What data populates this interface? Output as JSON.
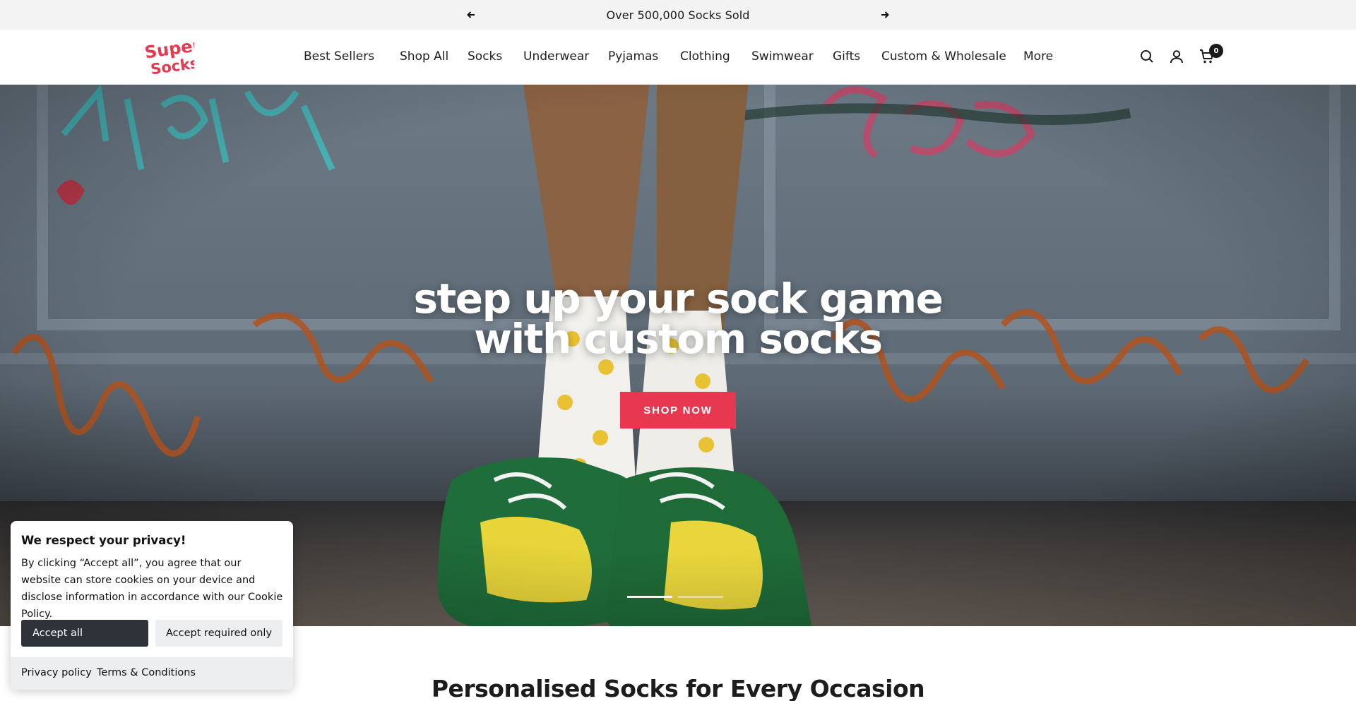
{
  "announcement": {
    "text": "Over 500,000 Socks Sold",
    "prev_icon": "arrow-left-icon",
    "next_icon": "arrow-right-icon"
  },
  "header": {
    "logo_text": "Super Socks",
    "nav": [
      {
        "label": "Best Sellers"
      },
      {
        "label": "Shop All"
      },
      {
        "label": "Socks"
      },
      {
        "label": "Underwear"
      },
      {
        "label": "Pyjamas"
      },
      {
        "label": "Clothing"
      },
      {
        "label": "Swimwear"
      },
      {
        "label": "Gifts"
      },
      {
        "label": "Custom & Wholesale"
      },
      {
        "label": "More"
      }
    ],
    "icons": [
      "search-icon",
      "account-icon",
      "cart-icon"
    ],
    "cart_count": "0"
  },
  "hero": {
    "title_line1": "step up your sock game",
    "title_line2": "with custom socks",
    "button_label": "SHOP NOW",
    "slide_count": 2,
    "active_slide": 1
  },
  "section": {
    "title": "Personalised Socks for Every Occasion"
  },
  "cookie": {
    "title": "We respect your privacy!",
    "body": "By clicking “Accept all”, you agree that our website can store cookies on your device and disclose information in accordance with our Cookie Policy.",
    "accept_all": "Accept all",
    "accept_required": "Accept required only",
    "privacy_link": "Privacy policy",
    "terms_link": "Terms & Conditions"
  },
  "colors": {
    "accent": "#e8384f",
    "dark_button": "#2d3339",
    "announcement_bg": "#f3f3f3"
  }
}
